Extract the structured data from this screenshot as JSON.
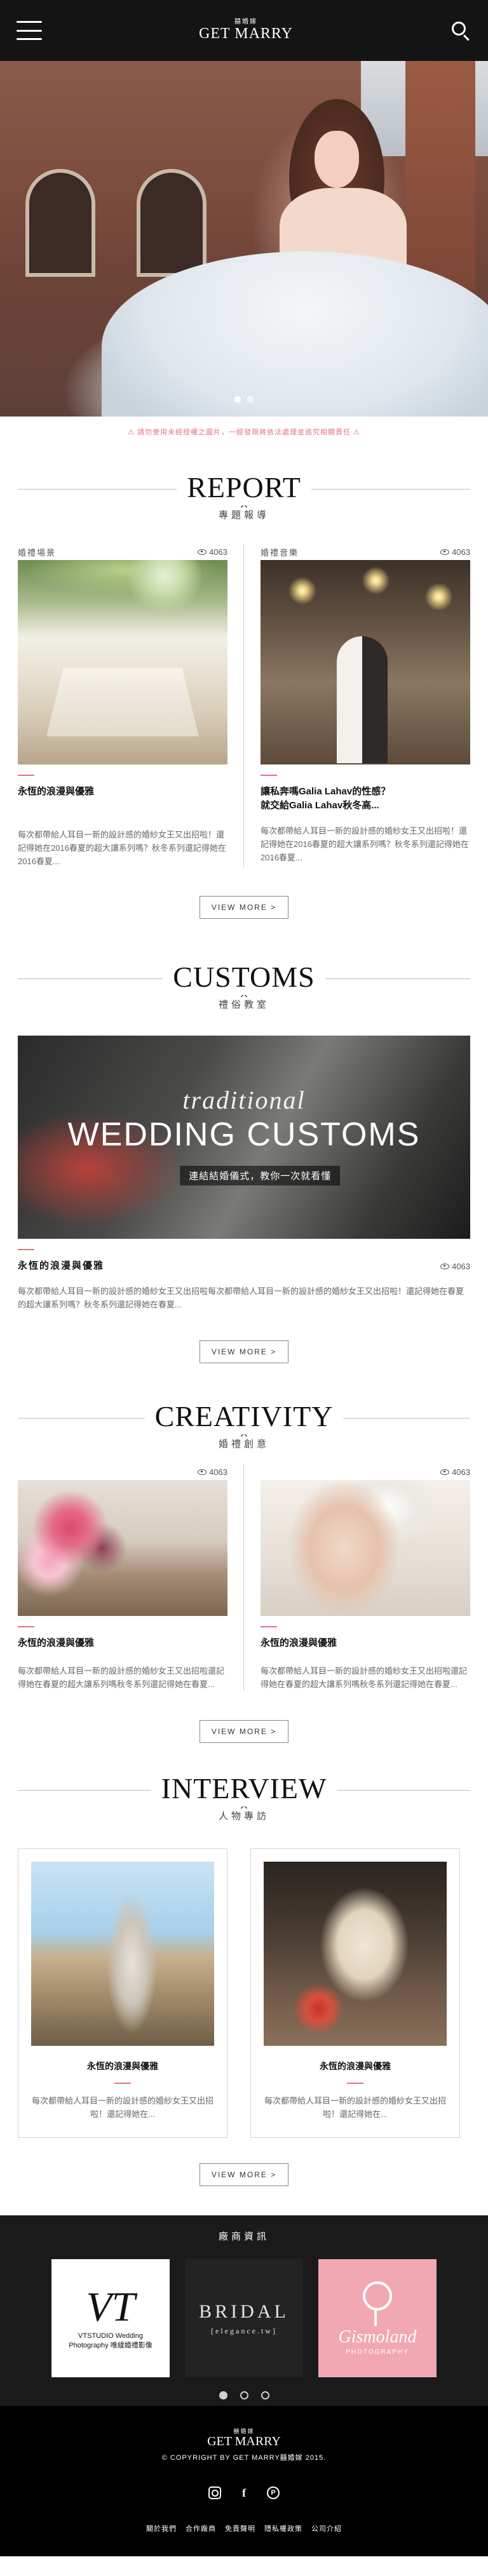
{
  "header": {
    "logo_small": "囍婚嫁",
    "logo_main": "GET MARRY"
  },
  "hero": {
    "slide_count": 2,
    "active_slide": 1
  },
  "notice": "⚠ 請勿使用未經授權之圖片，一經發現將依法處理並追究相關責任 ⚠",
  "report": {
    "title_en": "REPORT",
    "x": "✕",
    "title_zh": "專題報導",
    "cards": [
      {
        "category": "婚禮場景",
        "views": "4063",
        "title": "永恆的浪漫與優雅",
        "excerpt": "每次都帶給人耳目一新的設計感的婚紗女王又出招啦！還記得她在2016春夏的超大讓系列嗎？秋冬系列還記得她在2016春夏..."
      },
      {
        "category": "婚禮音樂",
        "views": "4063",
        "title": "讓私奔嗎Galia Lahav的性感？\n就交給Galia Lahav秋冬高...",
        "excerpt": "每次都帶給人耳目一新的設計感的婚紗女王又出招啦！還記得她在2016春夏的超大讓系列嗎？秋冬系列還記得她在2016春夏..."
      }
    ],
    "more_label": "VIEW MORE >"
  },
  "customs": {
    "title_en": "CUSTOMS",
    "x": "✕",
    "title_zh": "禮俗教室",
    "image_script": "traditional",
    "image_big": "WEDDING CUSTOMS",
    "image_banner": "連結結婚儀式，教你一次就看懂",
    "card_title": "永恆的浪漫與優雅",
    "views": "4063",
    "excerpt": "每次都帶給人耳目一新的設計感的婚紗女王又出招啦每次都帶給人耳目一新的設計感的婚紗女王又出招啦！還記得她在春夏的超大讓系列嗎？秋冬系列還記得她在春夏...",
    "more_label": "VIEW MORE >"
  },
  "creativity": {
    "title_en": "CREATIVITY",
    "x": "✕",
    "title_zh": "婚禮創意",
    "cards": [
      {
        "views": "4063",
        "title": "永恆的浪漫與優雅",
        "excerpt": "每次都帶給人耳目一新的設計感的婚紗女王又出招啦還記得她在春夏的超大讓系列嗎秋冬系列還記得她在春夏..."
      },
      {
        "views": "4063",
        "title": "永恆的浪漫與優雅",
        "excerpt": "每次都帶給人耳目一新的設計感的婚紗女王又出招啦還記得她在春夏的超大讓系列嗎秋冬系列還記得她在春夏..."
      }
    ],
    "more_label": "VIEW MORE >"
  },
  "interview": {
    "title_en": "INTERVIEW",
    "x": "✕",
    "title_zh": "人物專訪",
    "cards": [
      {
        "title": "永恆的浪漫與優雅",
        "excerpt": "每次都帶給人耳目一新的設計感的婚紗女王又出招啦！還記得她在..."
      },
      {
        "title": "永恆的浪漫與優雅",
        "excerpt": "每次都帶給人耳目一新的設計感的婚紗女王又出招啦！還記得她在..."
      }
    ],
    "more_label": "VIEW MORE >"
  },
  "vendors": {
    "title": "廠商資訊",
    "logos": [
      {
        "mono": "VT",
        "sub": "VTSTUDIO Wedding Photography 唯緹婚禮影像"
      },
      {
        "name": "BRIDAL",
        "sub": "[elegance.tw]"
      },
      {
        "name": "Gismoland",
        "sub": "PHOTOGRAPHY"
      }
    ],
    "page_count": 3,
    "active_page": 1
  },
  "footer": {
    "logo_small": "囍婚嫁",
    "logo_main": "GET MARRY",
    "copyright": "© COPYRIGHT BY GET MARRY囍婚嫁 2015.",
    "links": [
      "關於我們",
      "合作廠商",
      "免責聲明",
      "隱私權政策",
      "公司介紹"
    ]
  }
}
